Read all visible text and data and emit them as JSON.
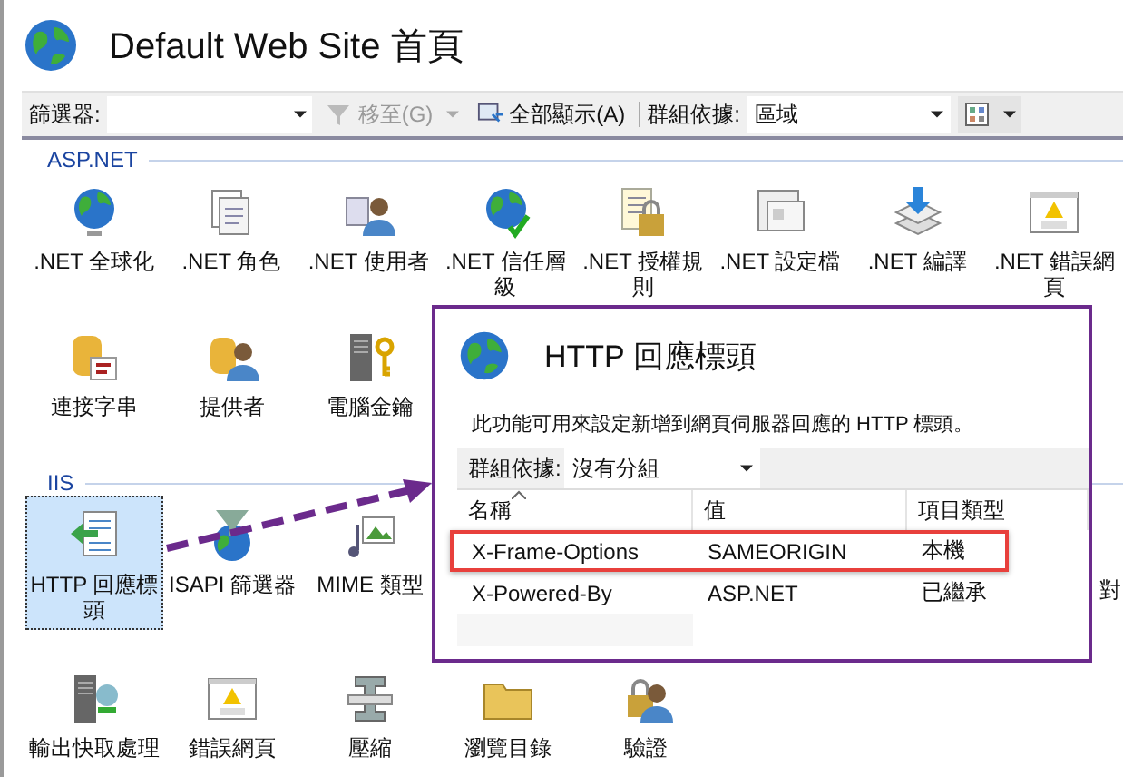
{
  "page": {
    "title": "Default Web Site 首頁"
  },
  "toolbar": {
    "filter_label": "篩選器:",
    "go_to": {
      "label": "移至(G)",
      "disabled": true
    },
    "show_all": "全部顯示(A)",
    "group_by_label": "群組依據:",
    "group_by_value": "區域"
  },
  "groups": [
    {
      "title": "ASP.NET",
      "rows": [
        {
          "items": [
            {
              "label": ".NET 全球化",
              "selected": false
            },
            {
              "label": ".NET 角色",
              "selected": false
            },
            {
              "label": ".NET 使用者",
              "selected": false
            },
            {
              "label": ".NET 信任層級",
              "selected": false
            },
            {
              "label": ".NET 授權規則",
              "selected": false
            },
            {
              "label": ".NET 設定檔",
              "selected": false
            },
            {
              "label": ".NET 編譯",
              "selected": false
            },
            {
              "label": ".NET 錯誤網頁",
              "selected": false
            }
          ]
        },
        {
          "items": [
            {
              "label": "連接字串",
              "selected": false
            },
            {
              "label": "提供者",
              "selected": false
            },
            {
              "label": "電腦金鑰",
              "selected": false
            }
          ]
        }
      ]
    },
    {
      "title": "IIS",
      "rows": [
        {
          "items": [
            {
              "label": "HTTP 回應標頭",
              "selected": true
            },
            {
              "label": "ISAPI 篩選器",
              "selected": false
            },
            {
              "label": "MIME 類型",
              "selected": false
            }
          ],
          "clipped_label": "對"
        },
        {
          "items": [
            {
              "label": "輸出快取處理",
              "selected": false
            },
            {
              "label": "錯誤網頁",
              "selected": false
            },
            {
              "label": "壓縮",
              "selected": false
            },
            {
              "label": "瀏覽目錄",
              "selected": false
            },
            {
              "label": "驗證",
              "selected": false
            }
          ]
        }
      ]
    }
  ],
  "panel": {
    "title": "HTTP 回應標頭",
    "description": "此功能可用來設定新增到網頁伺服器回應的 HTTP 標頭。",
    "group_by_label": "群組依據:",
    "group_by_value": "沒有分組",
    "columns": [
      "名稱",
      "值",
      "項目類型"
    ],
    "rows": [
      {
        "cells": [
          "X-Frame-Options",
          "SAMEORIGIN",
          "本機"
        ],
        "highlighted": true
      },
      {
        "cells": [
          "X-Powered-By",
          "ASP.NET",
          "已繼承"
        ],
        "highlighted": false
      }
    ]
  }
}
